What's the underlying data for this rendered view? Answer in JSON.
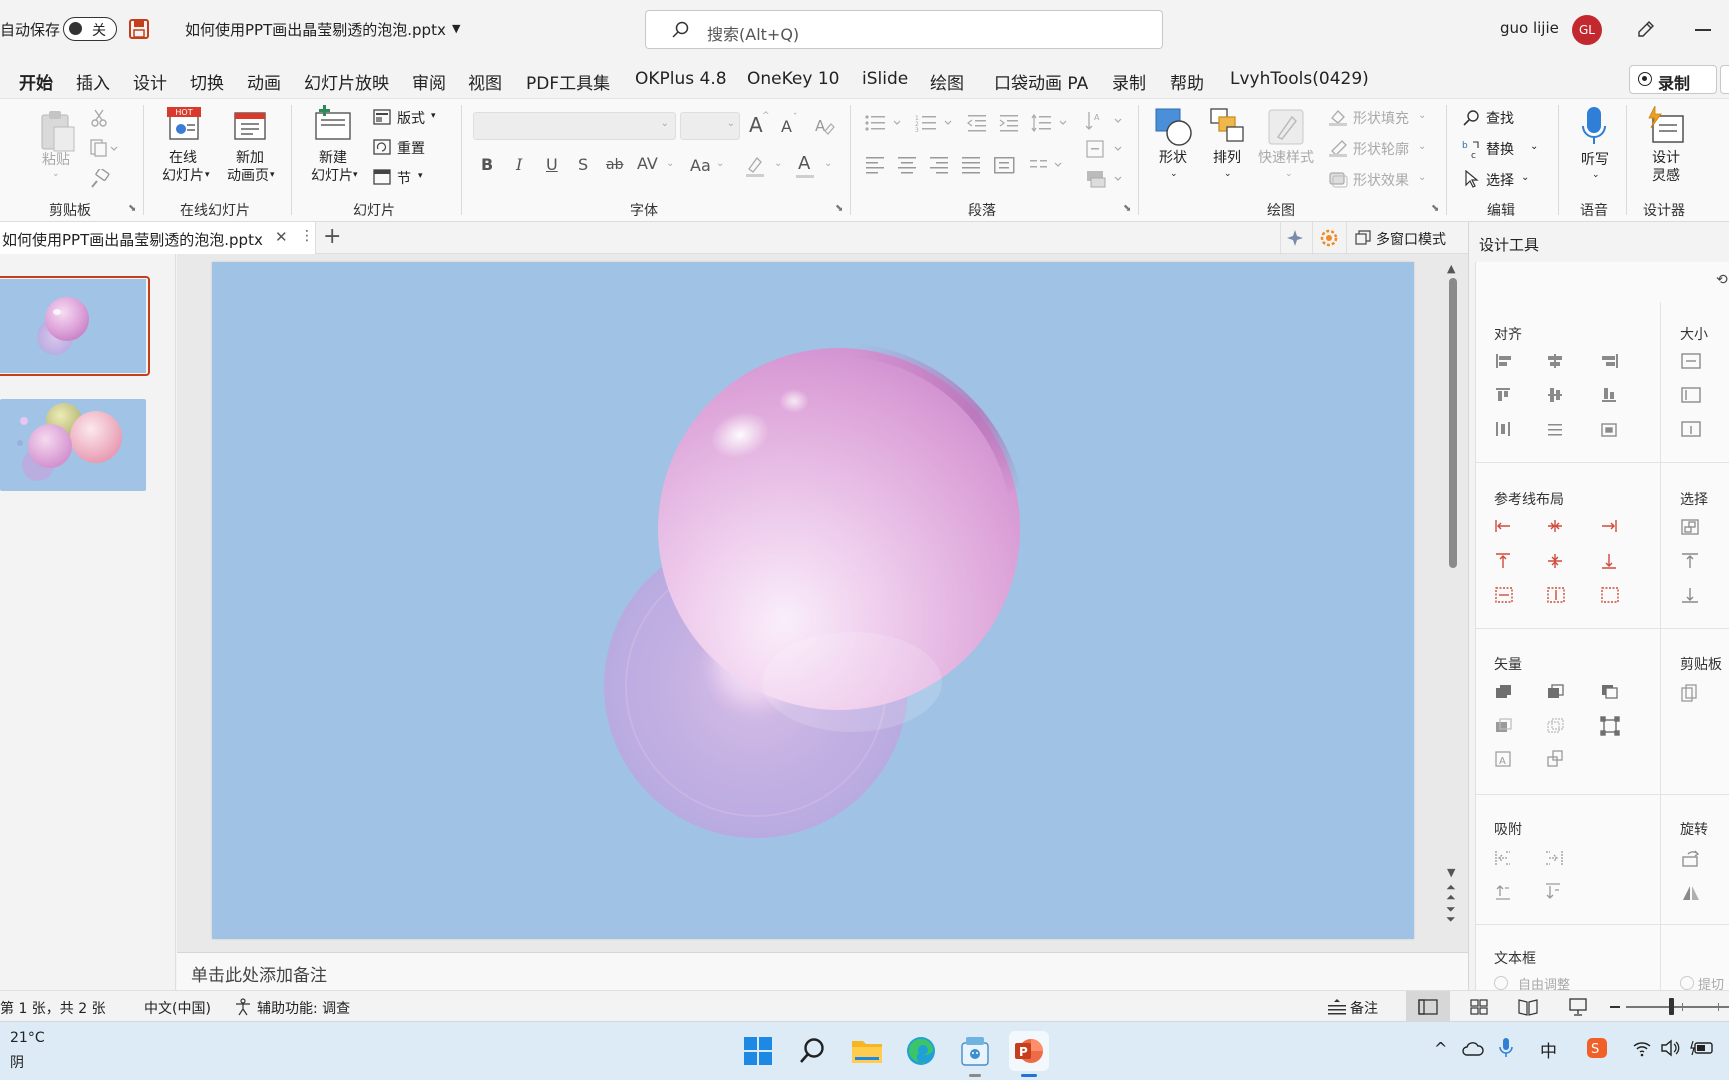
{
  "titlebar": {
    "autosave_label": "自动保存",
    "autosave_state": "关",
    "filename": "如何使用PPT画出晶莹剔透的泡泡.pptx",
    "search_placeholder": "搜索(Alt+Q)",
    "user_name": "guo lijie",
    "user_initials": "GL",
    "accent_color": "#c43e1c"
  },
  "menu": {
    "tabs": [
      "开始",
      "插入",
      "设计",
      "切换",
      "动画",
      "幻灯片放映",
      "审阅",
      "视图",
      "PDF工具集",
      "OKPlus 4.8",
      "OneKey 10",
      "iSlide",
      "绘图",
      "口袋动画 PA",
      "录制",
      "帮助",
      "LvyhTools(0429)"
    ],
    "active": "开始",
    "record_button": "录制"
  },
  "ribbon": {
    "clipboard": {
      "paste": "粘贴",
      "group": "剪贴板"
    },
    "online": {
      "online_slides_1": "在线",
      "online_slides_2": "幻灯片",
      "new_anim_1": "新加",
      "new_anim_2": "动画页",
      "group": "在线幻灯片",
      "hot_badge": "HOT"
    },
    "slides": {
      "new_slide_1": "新建",
      "new_slide_2": "幻灯片",
      "layout": "版式",
      "reset": "重置",
      "section": "节",
      "group": "幻灯片"
    },
    "font": {
      "group": "字体",
      "bold": "B",
      "italic": "I",
      "underline": "U",
      "shadow": "S",
      "strike": "ab",
      "spacing": "AV",
      "case": "Aa",
      "grow": "A",
      "shrink": "A",
      "color": "A"
    },
    "paragraph": {
      "group": "段落"
    },
    "drawing": {
      "shapes": "形状",
      "arrange": "排列",
      "quick_styles": "快速样式",
      "fill": "形状填充",
      "outline": "形状轮廓",
      "effects": "形状效果",
      "group": "绘图"
    },
    "editing": {
      "find": "查找",
      "replace": "替换",
      "select": "选择",
      "group": "编辑"
    },
    "voice": {
      "dictate": "听写",
      "group": "语音"
    },
    "designer": {
      "label_1": "设计",
      "label_2": "灵感",
      "group": "设计器"
    }
  },
  "doc_tabs": {
    "filename": "如何使用PPT画出晶莹剔透的泡泡.pptx",
    "multiwindow": "多窗口模式"
  },
  "notes_placeholder": "单击此处添加备注",
  "design_pane": {
    "title": "设计工具",
    "sections": {
      "align": "对齐",
      "size": "大小",
      "guides": "参考线布局",
      "select": "选择",
      "vector": "矢量",
      "clipboard": "剪贴板",
      "snap": "吸附",
      "rotate": "旋转",
      "textbox": "文本框",
      "autofit": "自由调整",
      "advanced": "提切文"
    }
  },
  "statusbar": {
    "slide_info": "第 1 张，共 2 张",
    "language": "中文(中国)",
    "accessibility": "辅助功能: 调查",
    "notes_button": "备注"
  },
  "taskbar": {
    "weather_temp": "21°C",
    "weather_desc": "阴"
  }
}
